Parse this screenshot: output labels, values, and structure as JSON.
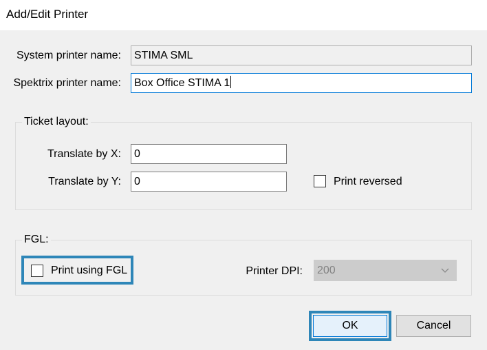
{
  "window": {
    "title": "Add/Edit Printer"
  },
  "system_printer": {
    "label": "System printer name:",
    "value": "STIMA SML"
  },
  "spektrix_printer": {
    "label": "Spektrix printer name:",
    "value": "Box Office STIMA 1"
  },
  "ticket_layout": {
    "legend": "Ticket layout:",
    "translate_x_label": "Translate by X:",
    "translate_x_value": "0",
    "translate_y_label": "Translate by Y:",
    "translate_y_value": "0",
    "print_reversed_label": "Print reversed",
    "print_reversed_checked": false
  },
  "fgl": {
    "legend": "FGL:",
    "print_using_fgl_label": "Print using FGL",
    "print_using_fgl_checked": false,
    "printer_dpi_label": "Printer DPI:",
    "printer_dpi_value": "200",
    "printer_dpi_enabled": false
  },
  "buttons": {
    "ok": "OK",
    "cancel": "Cancel"
  },
  "colors": {
    "highlight": "#2e86b8",
    "focus_border": "#0078d7",
    "dialog_background": "#f0f0f0"
  },
  "icons": {
    "dropdown": "chevron-down-icon"
  }
}
